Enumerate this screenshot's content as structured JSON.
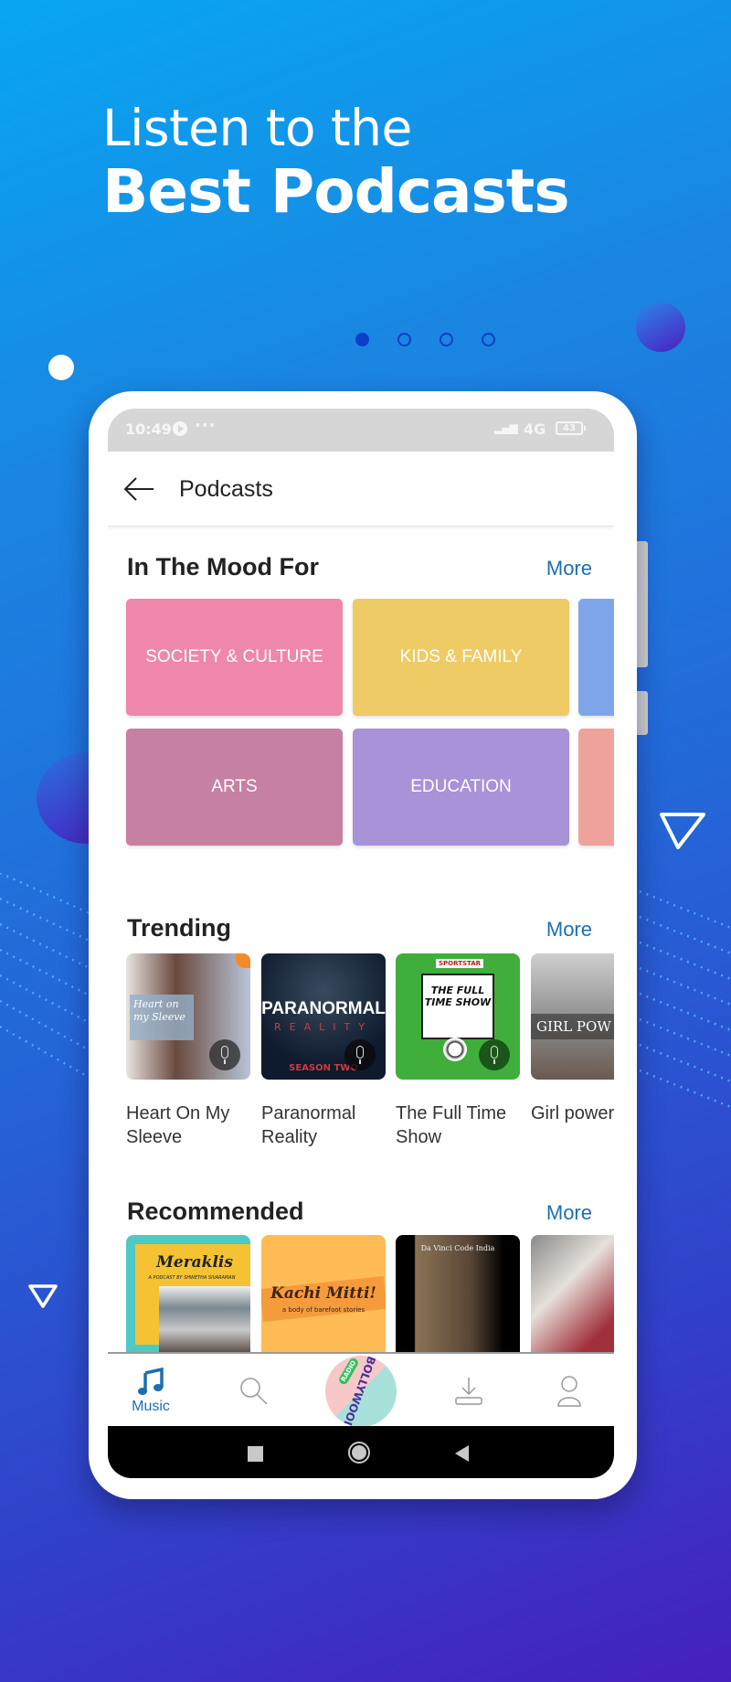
{
  "promo": {
    "headline_line1": "Listen to the",
    "headline_line2": "Best Podcasts",
    "pager": {
      "total": 4,
      "active_index": 0
    }
  },
  "statusbar": {
    "time": "10:49",
    "overflow": "···",
    "network": "4G",
    "battery": "43"
  },
  "appbar": {
    "back_icon": "arrow-left-icon",
    "title": "Podcasts"
  },
  "sections": {
    "mood": {
      "title": "In The Mood For",
      "more": "More",
      "tiles": [
        {
          "label": "SOCIETY & CULTURE",
          "color": "#ef86ab"
        },
        {
          "label": "KIDS & FAMILY",
          "color": "#eecb65"
        },
        {
          "label": "",
          "color": "#80a6ea"
        },
        {
          "label": "ARTS",
          "color": "#c680a2"
        },
        {
          "label": "EDUCATION",
          "color": "#a892d8"
        },
        {
          "label": "",
          "color": "#eda39c"
        }
      ]
    },
    "trending": {
      "title": "Trending",
      "more": "More",
      "items": [
        {
          "title_line1": "Heart On My",
          "title_line2": "Sleeve",
          "cover_text": "Heart on my Sleeve"
        },
        {
          "title_line1": "Paranormal",
          "title_line2": "Reality",
          "cover_text": "PARANORMAL",
          "cover_sub": "REALITY",
          "cover_badge": "SEASON TWO"
        },
        {
          "title_line1": "The Full Time",
          "title_line2": "Show",
          "cover_text": "THE FULL TIME SHOW",
          "cover_badge": "SPORTSTAR"
        },
        {
          "title_line1": "Girl power",
          "title_line2": "",
          "cover_text": "GIRL POW"
        }
      ]
    },
    "recommended": {
      "title": "Recommended",
      "more": "More",
      "items": [
        {
          "cover_text": "Meraklis",
          "cover_sub": "A PODCAST BY SHWETHA SIVARAMAN"
        },
        {
          "cover_text": "Kachi Mitti!",
          "cover_sub": "a body of barefoot stories"
        },
        {
          "cover_text": "Da Vinci Code India"
        },
        {
          "cover_text": ""
        }
      ]
    }
  },
  "bottomnav": {
    "items": [
      {
        "label": "Music",
        "icon": "music-note-icon",
        "active": true
      },
      {
        "label": "",
        "icon": "search-icon",
        "active": false
      },
      {
        "label": "",
        "icon": "radio-bollywood-icon",
        "active": false,
        "cover_text": "BOLLYWOOD",
        "cover_badge": "RADIO"
      },
      {
        "label": "",
        "icon": "download-icon",
        "active": false
      },
      {
        "label": "",
        "icon": "profile-icon",
        "active": false
      }
    ],
    "active_color": "#1c6fb1"
  },
  "sysnav": {
    "recents": "square-icon",
    "home": "circle-icon",
    "back": "triangle-back-icon"
  }
}
